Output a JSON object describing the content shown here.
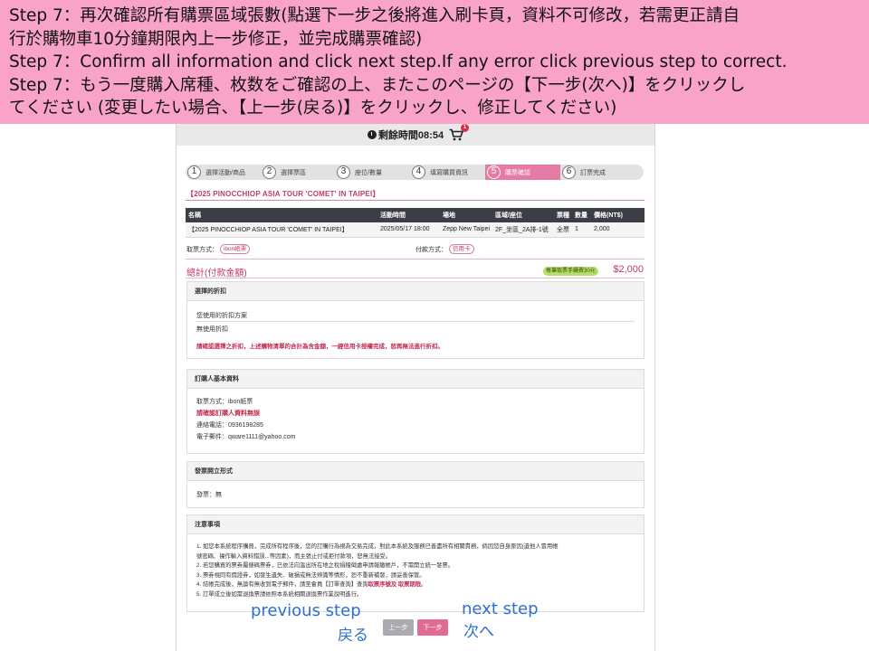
{
  "instructions": [
    "Step 7：再次確認所有購票區域張數(點選下一步之後將進入刷卡頁，資料不可修改，若需更正請自",
    "行於購物車10分鐘期限內上一步修正，並完成購票確認)",
    "Step 7：Confirm all information and click next step.If any error click previous step to correct.",
    "Step 7：もう一度購入席種、枚数をご確認の上、またこのページの【下一步(次へ)】をクリックし",
    "てください (変更したい場合、【上一步(戻る)】をクリックし、修正してください)"
  ],
  "header": {
    "timer_label": "剩餘時間08:54",
    "cart_count": "1"
  },
  "steps": [
    {
      "num": "1",
      "label": "選擇活動/商品"
    },
    {
      "num": "2",
      "label": "選擇票區"
    },
    {
      "num": "3",
      "label": "座位/數量"
    },
    {
      "num": "4",
      "label": "填寫購買資訊"
    },
    {
      "num": "5",
      "label": "購票確認"
    },
    {
      "num": "6",
      "label": "訂票完成"
    }
  ],
  "event_title": "【2025 PINOCCHIOP ASIA TOUR 'COMET' IN TAIPEI】",
  "order_table": {
    "headers": [
      "名稱",
      "活動時間",
      "場地",
      "區域/座位",
      "票種",
      "數量",
      "價格(NT$)"
    ],
    "row": [
      "【2025 PINOCCHIOP ASIA TOUR 'COMET' IN TAIPEI】",
      "2025/05/17 18:00",
      "Zepp New Taipei",
      "2F_坐區_2A排-1號",
      "全票",
      "1",
      "2,000"
    ]
  },
  "pickup": {
    "label": "取票方式：",
    "value": "ibon紙票"
  },
  "payment": {
    "label": "付款方式：",
    "value": "信用卡"
  },
  "total": {
    "label": "總計(付款金額)",
    "fee": "每筆取票手續費30元",
    "amount": "$2,000"
  },
  "discount": {
    "title": "選擇的折扣",
    "plan_label": "您使用的折扣方案",
    "plan_value": "無使用折扣",
    "warning": "請確認選擇之折扣，上述購物清單的合計為含金額，一經信用卡授權完成，恕再無法進行折扣。"
  },
  "buyer": {
    "title": "訂購人基本資料",
    "pickup": "取票方式：ibon紙票",
    "confirm": "請確認訂購人資料無誤",
    "phone": "連絡電話：0936198285",
    "email": "電子郵件：qware1111@yahoo.com"
  },
  "invoice": {
    "title": "發票開立形式",
    "value": "發票：無"
  },
  "notes": {
    "title": "注意事項",
    "lines": [
      "1. 如您本系統程序購買，完成所有程序後，您的訂購行為視為交易完成，對此本系統及服務已善盡所有相關責務，倘因您自身原因(遺他人冒用帳",
      "號密碼、操作輸入資料錯誤...等因素)，而主張止付或拒付款項，恕無法接受。",
      "2. 若您購買的票券屬條碼票券，已依法向溫出所在地之稅捐稽徵處申請報繳帳戶，不需開立統一發票。",
      "3. 票券視同有價證券，如發生遺失、破損或無法辨識等情形，恕不重新補發，請妥善保管。",
      "5. 訂單成立後如需退換票請依照本系統相關退換票作業說明進行。"
    ],
    "line4_pre": "4. 結帳完成後，無論有無收到電子郵件，請至會員【訂單查詢】查詢",
    "line4_red": "取票序號及 取票期限",
    "line4_post": "。"
  },
  "buttons": {
    "prev": "上一步",
    "next": "下一步"
  },
  "annotations": {
    "prev_en": "previous step",
    "prev_ja": "戻る",
    "next_en": "next step",
    "next_ja": "次へ"
  }
}
